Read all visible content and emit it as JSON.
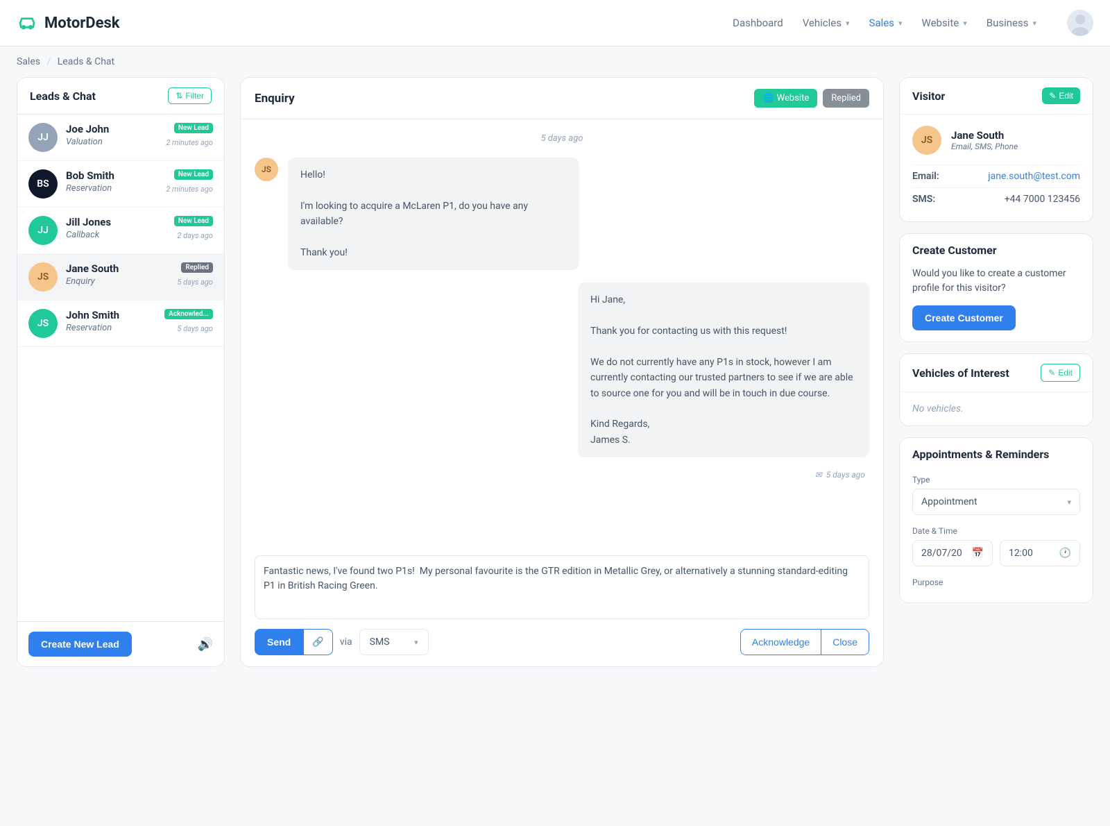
{
  "brand": "MotorDesk",
  "nav": {
    "dashboard": "Dashboard",
    "vehicles": "Vehicles",
    "sales": "Sales",
    "website": "Website",
    "business": "Business"
  },
  "breadcrumb": {
    "a": "Sales",
    "b": "Leads & Chat"
  },
  "leads": {
    "title": "Leads & Chat",
    "filter": "Filter",
    "create": "Create New Lead",
    "items": [
      {
        "initials": "JJ",
        "color": "#94a3b8",
        "name": "Joe John",
        "sub": "Valuation",
        "badge": "New Lead",
        "badgeClass": "teal",
        "time": "2 minutes ago"
      },
      {
        "initials": "BS",
        "color": "#0f172a",
        "name": "Bob Smith",
        "sub": "Reservation",
        "badge": "New Lead",
        "badgeClass": "teal",
        "time": "2 minutes ago"
      },
      {
        "initials": "JJ",
        "color": "#20c997",
        "name": "Jill Jones",
        "sub": "Callback",
        "badge": "New Lead",
        "badgeClass": "teal",
        "time": "2 days ago"
      },
      {
        "initials": "JS",
        "color": "#f5c58b",
        "name": "Jane South",
        "sub": "Enquiry",
        "badge": "Replied",
        "badgeClass": "grey",
        "time": "5 days ago",
        "selected": true
      },
      {
        "initials": "JS",
        "color": "#20c997",
        "name": "John Smith",
        "sub": "Reservation",
        "badge": "Acknowled...",
        "badgeClass": "teal",
        "time": "5 days ago"
      }
    ]
  },
  "chat": {
    "title": "Enquiry",
    "websiteBadge": "Website",
    "statusBadge": "Replied",
    "date": "5 days ago",
    "msg1": {
      "initials": "JS",
      "color": "#f5c58b",
      "text": "Hello!\n\nI'm looking to acquire a McLaren P1, do you have any available?\n\nThank you!"
    },
    "msg2": {
      "text": "Hi Jane,\n\nThank you for contacting us with this request!\n\nWe do not currently have any P1s in stock, however I am currently contacting our trusted partners to see if we are able to source one for you and will be in touch in due course.\n\nKind Regards,\nJames S."
    },
    "msgTime": "5 days ago",
    "compose": "Fantastic news, I've found two P1s!  My personal favourite is the GTR edition in Metallic Grey, or alternatively a stunning standard-editing P1 in British Racing Green.",
    "send": "Send",
    "via": "via",
    "channel": "SMS",
    "ack": "Acknowledge",
    "close": "Close"
  },
  "visitor": {
    "title": "Visitor",
    "edit": "Edit",
    "initials": "JS",
    "color": "#f5c58b",
    "name": "Jane South",
    "sub": "Email, SMS, Phone",
    "emailLabel": "Email:",
    "email": "jane.south@test.com",
    "smsLabel": "SMS:",
    "sms": "+44 7000 123456"
  },
  "createCustomer": {
    "title": "Create Customer",
    "text": "Would you like to create a customer profile for this visitor?",
    "btn": "Create Customer"
  },
  "vehicles": {
    "title": "Vehicles of Interest",
    "edit": "Edit",
    "empty": "No vehicles."
  },
  "appt": {
    "title": "Appointments & Reminders",
    "typeLabel": "Type",
    "type": "Appointment",
    "dateLabel": "Date & Time",
    "date": "28/07/20",
    "time": "12:00",
    "purposeLabel": "Purpose"
  }
}
